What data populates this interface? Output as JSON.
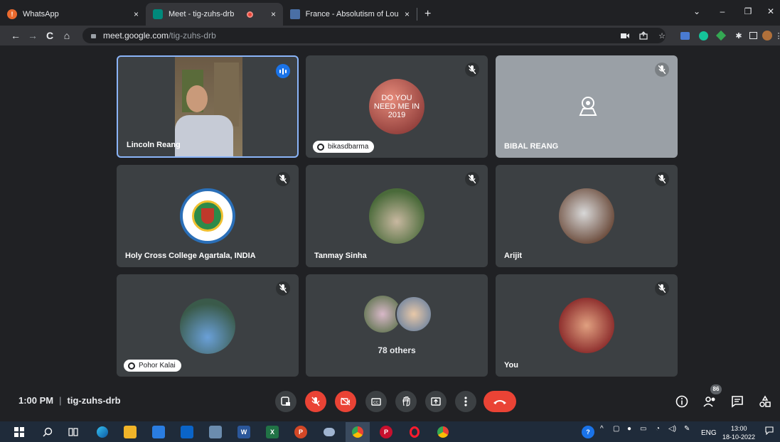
{
  "tabs": [
    {
      "title": "WhatsApp",
      "icon": "whatsapp-icon",
      "close": "×"
    },
    {
      "title": "Meet - tig-zuhs-drb",
      "icon": "meet-icon",
      "close": "×"
    },
    {
      "title": "France - Absolutism of Louis | Bri",
      "icon": "page-icon",
      "close": "×"
    }
  ],
  "new_tab": "+",
  "window": {
    "dropdown": "⌄",
    "minimize": "–",
    "restore": "❐",
    "close": "✕"
  },
  "nav": {
    "back": "←",
    "forward": "→",
    "reload": "C",
    "home": "⌂"
  },
  "address": {
    "host": "meet.google.com",
    "path": "/tig-zuhs-drb"
  },
  "participants": [
    {
      "name": "Lincoln Reang",
      "kind": "video",
      "speaking": true
    },
    {
      "name": "bikasdbarma",
      "kind": "avatar",
      "avatar_text": "DO YOU\nNEED ME IN\n2019",
      "chip": true
    },
    {
      "name": "BIBAL REANG",
      "kind": "no-camera"
    },
    {
      "name": "Holy Cross College Agartala, INDIA",
      "kind": "logo"
    },
    {
      "name": "Tanmay Sinha",
      "kind": "avatar"
    },
    {
      "name": "Arijit",
      "kind": "avatar"
    },
    {
      "name": "Pohor Kalai",
      "kind": "avatar",
      "chip": true
    },
    {
      "name": "78 others",
      "kind": "others"
    },
    {
      "name": "You",
      "kind": "avatar"
    }
  ],
  "meeting": {
    "time": "1:00 PM",
    "separator": "|",
    "code": "tig-zuhs-drb",
    "participant_count": "86"
  },
  "taskbar": {
    "lang": "ENG",
    "time": "13:00",
    "date": "18-10-2022"
  },
  "colors": {
    "accent": "#8ab4f8",
    "hangup": "#ea4335",
    "tile": "#3c4043",
    "bg": "#202124"
  }
}
